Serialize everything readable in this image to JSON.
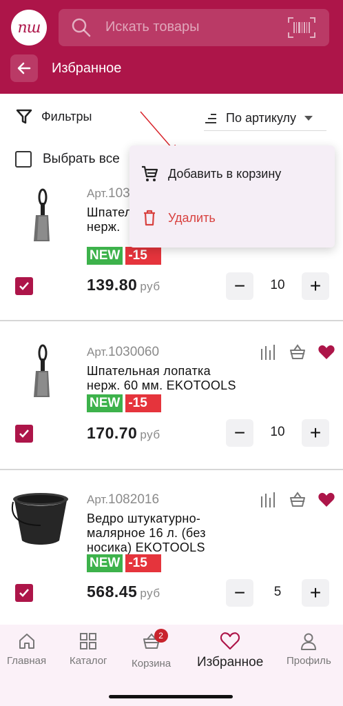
{
  "header": {
    "logo_text": "пш",
    "search_placeholder": "Искать товары",
    "title": "Избранное",
    "brand_color": "#ad1549"
  },
  "toolbar": {
    "filters_label": "Фильтры",
    "sort_label": "По артикулу",
    "select_all_label": "Выбрать все"
  },
  "menu": {
    "add_to_cart": "Добавить в корзину",
    "delete": "Удалить"
  },
  "products": [
    {
      "art_prefix": "Арт.",
      "art_number": "103",
      "name": "Шпатель\nнерж.",
      "badge_new": "NEW",
      "badge_discount": "-15",
      "price": "139.80",
      "currency": "руб",
      "quantity": "10",
      "checked": true,
      "image": "spatula-icon"
    },
    {
      "art_prefix": "Арт.",
      "art_number": "1030060",
      "name": "Шпательная лопатка\nнерж. 60 мм. EKOTOOLS",
      "badge_new": "NEW",
      "badge_discount": "-15",
      "price": "170.70",
      "currency": "руб",
      "quantity": "10",
      "checked": true,
      "image": "spatula-icon"
    },
    {
      "art_prefix": "Арт.",
      "art_number": "1082016",
      "name": "Ведро штукатурно-\nмалярное 16 л. (без\nносика)  EKOTOOLS",
      "badge_new": "NEW",
      "badge_discount": "-15",
      "price": "568.45",
      "currency": "руб",
      "quantity": "5",
      "checked": true,
      "image": "bucket-icon"
    }
  ],
  "bottom_nav": {
    "items": [
      {
        "label": "Главная",
        "icon": "home-icon"
      },
      {
        "label": "Каталог",
        "icon": "grid-icon"
      },
      {
        "label": "Корзина",
        "icon": "basket-icon",
        "badge": "2"
      },
      {
        "label": "Избранное",
        "icon": "heart-icon",
        "active": true
      },
      {
        "label": "Профиль",
        "icon": "profile-icon"
      }
    ]
  }
}
